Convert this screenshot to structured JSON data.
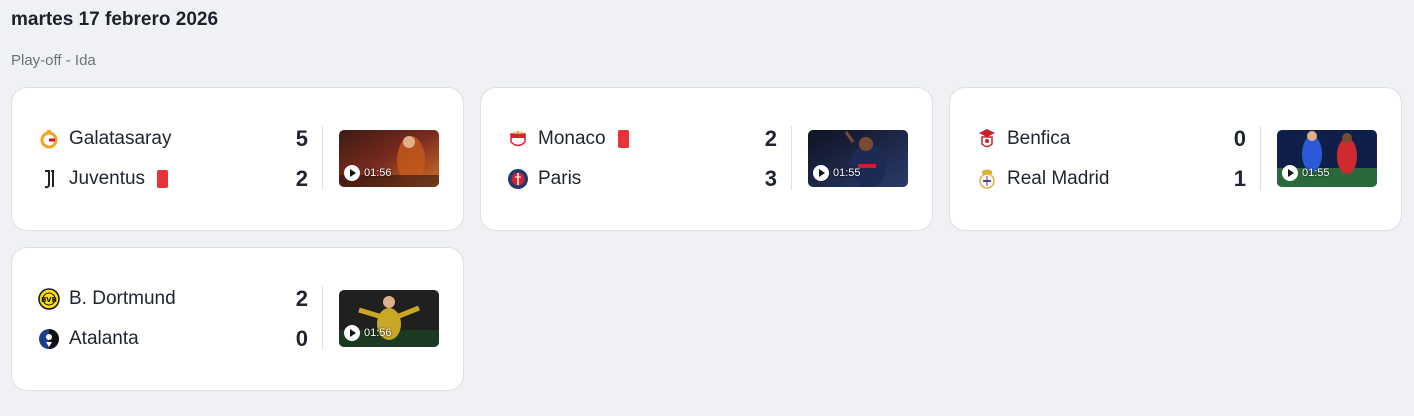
{
  "header": {
    "date": "martes 17 febrero 2026",
    "round": "Play-off - Ida"
  },
  "matches": [
    {
      "home": {
        "name": "Galatasaray",
        "score": "5",
        "crest": "galatasaray-crest-icon",
        "red_card": false
      },
      "away": {
        "name": "Juventus",
        "score": "2",
        "crest": "juventus-crest-icon",
        "red_card": true
      },
      "video_duration": "01:56",
      "thumb_colors": [
        "#7a2a1e",
        "#d4742a"
      ]
    },
    {
      "home": {
        "name": "Monaco",
        "score": "2",
        "crest": "monaco-crest-icon",
        "red_card": true
      },
      "away": {
        "name": "Paris",
        "score": "3",
        "crest": "psg-crest-icon",
        "red_card": false
      },
      "video_duration": "01:55",
      "thumb_colors": [
        "#141a2e",
        "#2a3a6a"
      ]
    },
    {
      "home": {
        "name": "Benfica",
        "score": "0",
        "crest": "benfica-crest-icon",
        "red_card": false
      },
      "away": {
        "name": "Real Madrid",
        "score": "1",
        "crest": "real-madrid-crest-icon",
        "red_card": false
      },
      "video_duration": "01:55",
      "thumb_colors": [
        "#1b3f9a",
        "#c8202c"
      ]
    },
    {
      "home": {
        "name": "B. Dortmund",
        "score": "2",
        "crest": "dortmund-crest-icon",
        "red_card": false
      },
      "away": {
        "name": "Atalanta",
        "score": "0",
        "crest": "atalanta-crest-icon",
        "red_card": false
      },
      "video_duration": "01:56",
      "thumb_colors": [
        "#2a2a2a",
        "#c9a826"
      ]
    }
  ],
  "colors": {
    "background": "#f0f1f5",
    "card": "#ffffff",
    "red_card": "#e8323c",
    "text": "#1e2530"
  }
}
